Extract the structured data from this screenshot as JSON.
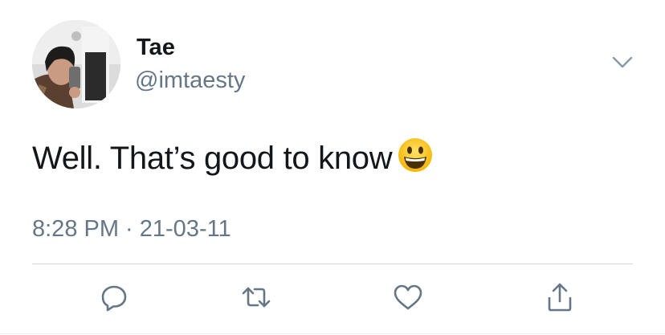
{
  "author": {
    "display_name": "Tae",
    "handle": "@imtaesty",
    "avatar_icon": "avatar-photo"
  },
  "tweet": {
    "text": "Well. That’s good to know",
    "emoji": "grinning-face-emoji",
    "timestamp": "8:28 PM · 21-03-11"
  },
  "actions": [
    {
      "name": "reply",
      "icon": "reply-icon"
    },
    {
      "name": "retweet",
      "icon": "retweet-icon"
    },
    {
      "name": "like",
      "icon": "heart-icon"
    },
    {
      "name": "share",
      "icon": "share-icon"
    }
  ],
  "colors": {
    "text_primary": "#14171a",
    "text_secondary": "#657786",
    "icon": "#657786",
    "divider": "#d4d8dc"
  }
}
